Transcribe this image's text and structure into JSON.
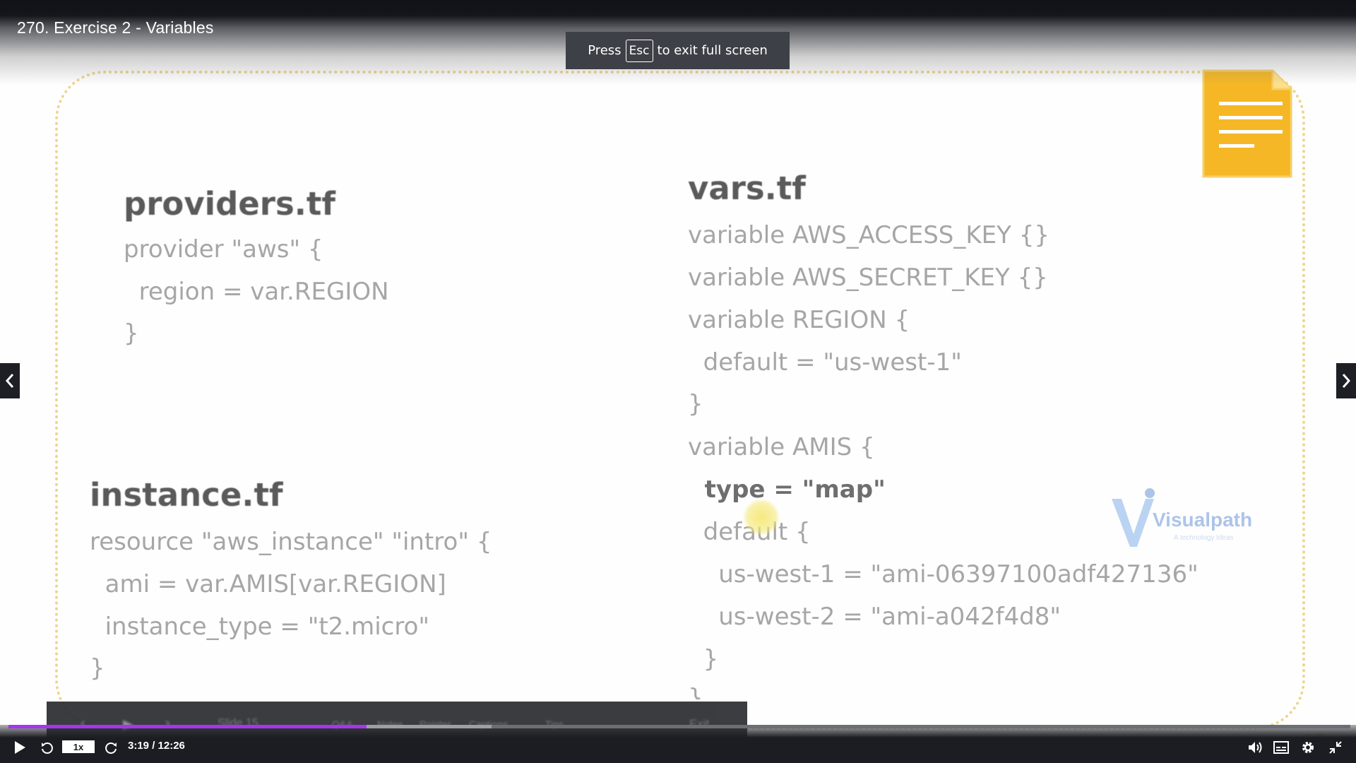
{
  "video": {
    "title": "270. Exercise 2 - Variables"
  },
  "fullscreen_toast": {
    "before": "Press",
    "key": "Esc",
    "after": "to exit full screen"
  },
  "slide": {
    "providers": {
      "heading": "providers.tf",
      "lines": [
        "provider \"aws\" {",
        "  region = var.REGION",
        "}"
      ]
    },
    "instance": {
      "heading": "instance.tf",
      "lines": [
        "resource \"aws_instance\" \"intro\" {",
        "  ami = var.AMIS[var.REGION]",
        "  instance_type = \"t2.micro\"",
        "}"
      ]
    },
    "vars": {
      "heading": "vars.tf",
      "lines": [
        "variable AWS_ACCESS_KEY {}",
        "variable AWS_SECRET_KEY {}",
        "variable REGION {",
        "  default = \"us-west-1\"",
        "}",
        "variable AMIS {",
        "  type = \"map\"",
        "  default {",
        "    us-west-1 = \"ami-06397100adf427136\"",
        "    us-west-2 = \"ami-a042f4d8\"",
        "  }",
        "}"
      ]
    },
    "watermark": {
      "name": "Visualpath",
      "tagline": "A technology Ideas"
    },
    "toolbar": {
      "slide_label": "Slide 15",
      "items": [
        "Q&A",
        "Notes",
        "Pointer",
        "Captions",
        "Tips",
        "Exit"
      ]
    },
    "page_number": "15"
  },
  "player": {
    "speed": "1x",
    "time": "3:19 / 12:26",
    "progress_fraction": 0.267,
    "buffer_fraction": 0.36
  },
  "colors": {
    "accent": "#a435f0",
    "doc_icon": "#f7bb2c",
    "frame": "#f0d38a"
  }
}
